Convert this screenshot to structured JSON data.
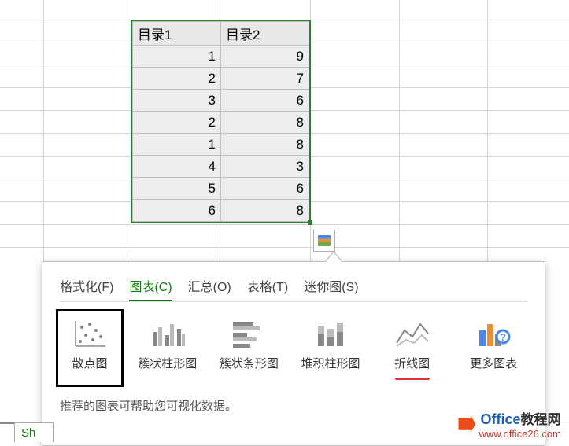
{
  "table": {
    "headers": [
      "目录1",
      "目录2"
    ],
    "rows": [
      [
        1,
        9
      ],
      [
        2,
        7
      ],
      [
        3,
        6
      ],
      [
        2,
        8
      ],
      [
        1,
        8
      ],
      [
        4,
        3
      ],
      [
        5,
        6
      ],
      [
        6,
        8
      ]
    ]
  },
  "tabs": {
    "format": "格式化(F)",
    "chart": "图表(C)",
    "total": "汇总(O)",
    "table": "表格(T)",
    "sparkline": "迷你图(S)",
    "active": "chart"
  },
  "chart_options": {
    "scatter": "散点图",
    "clustered_column": "簇状柱形图",
    "clustered_bar": "簇状条形图",
    "stacked_column": "堆积柱形图",
    "line": "折线图",
    "more": "更多图表"
  },
  "hint": "推荐的图表可帮助您可视化数据。",
  "sheet_tab": "Sh",
  "watermark": {
    "brand1": "Office",
    "brand2": "教程网",
    "url": "www.office26.com"
  }
}
